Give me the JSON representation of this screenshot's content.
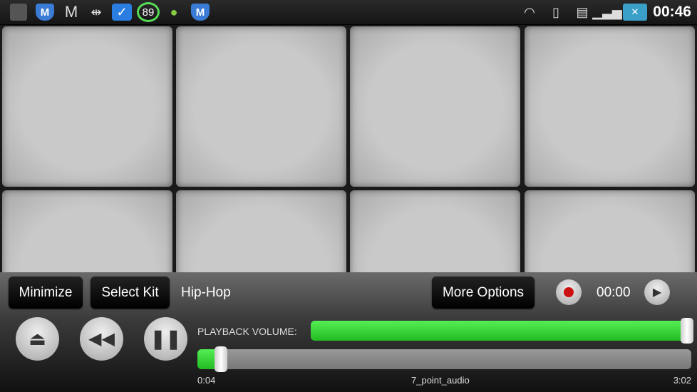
{
  "status_bar": {
    "icons": [
      "phone-icon",
      "shield-m-icon",
      "gmail-icon",
      "usb-icon",
      "app-alert-icon",
      "battery-89-icon",
      "android-icon",
      "shield-m-icon"
    ],
    "battery_badge": "89",
    "right_icons": [
      "wifi-icon",
      "vibrate-icon",
      "sim-icon",
      "signal-icon",
      "battery-icon"
    ],
    "time": "00:46"
  },
  "pads": {
    "count": 8
  },
  "controls": {
    "minimize": "Minimize",
    "select_kit": "Select Kit",
    "kit_name": "Hip-Hop",
    "more_options": "More Options",
    "record_time": "00:00",
    "playback_volume_label": "PLAYBACK VOLUME:",
    "volume_percent": 100,
    "progress_percent": 2.2,
    "elapsed": "0:04",
    "track_name": "7_point_audio",
    "duration": "3:02",
    "colors": {
      "green": "#3fd23f",
      "record": "#cc1111"
    }
  }
}
